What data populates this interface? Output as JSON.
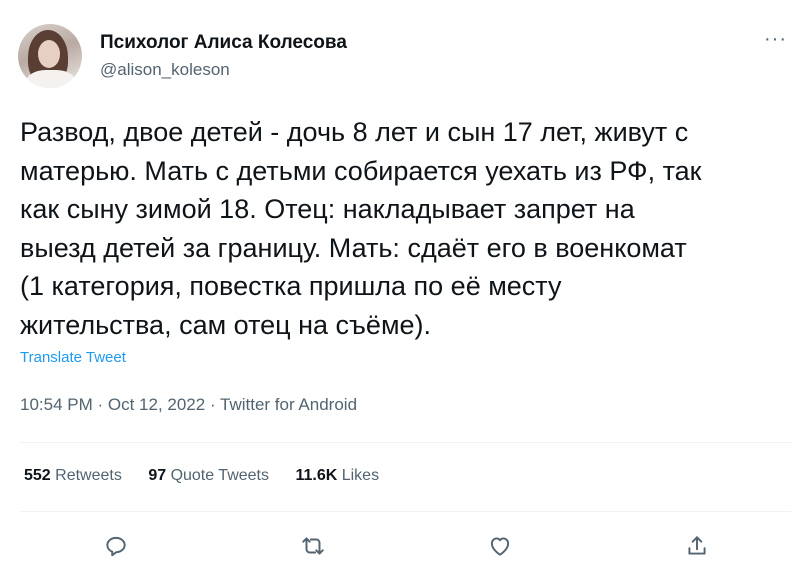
{
  "author": {
    "display_name": "Психолог Алиса Колесова",
    "handle": "@alison_koleson"
  },
  "menu_label": "···",
  "tweet": {
    "lines": [
      "Развод, двое детей - дочь 8 лет и сын 17 лет, живут с",
      "матерью. Мать с детьми собирается уехать из РФ, так",
      "как сыну зимой 18. Отец: накладывает запрет на",
      "выезд детей за границу. Мать: сдаёт его в военкомат",
      "(1 категория, повестка пришла по её месту",
      "жительства, сам отец на съёме)."
    ]
  },
  "translate_label": "Translate Tweet",
  "meta": "10:54 PM · Oct 12, 2022 · Twitter for Android",
  "stats": {
    "retweets_count": "552",
    "retweets_label": "Retweets",
    "quotes_count": "97",
    "quotes_label": "Quote Tweets",
    "likes_count": "11.6K",
    "likes_label": "Likes"
  },
  "actions": [
    "reply-icon",
    "retweet-icon",
    "like-icon",
    "share-icon"
  ],
  "colors": {
    "text": "#0f1419",
    "secondary": "#536471",
    "link": "#1d9bf0",
    "divider": "#eff3f4"
  }
}
